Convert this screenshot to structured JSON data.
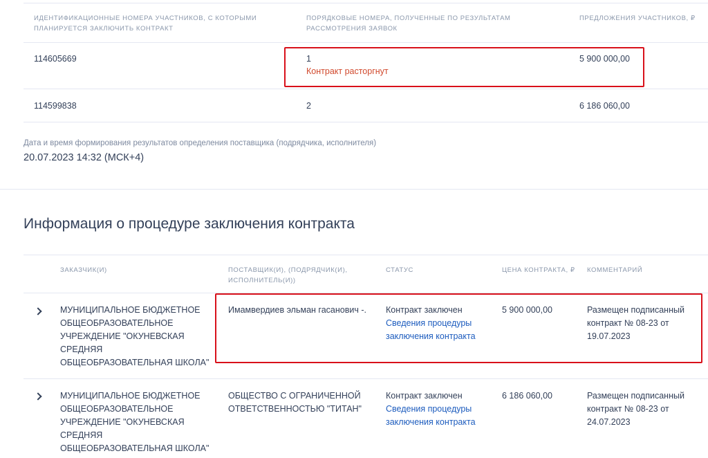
{
  "participants_table": {
    "headers": [
      "Идентификационные номера участников, с которыми планируется заключить контракт",
      "Порядковые номера, полученные по результатам рассмотрения заявок",
      "Предложения участников, ₽"
    ],
    "rows": [
      {
        "id": "114605669",
        "rank": "1",
        "rank_note": "Контракт расторгнут",
        "offer": "5 900 000,00"
      },
      {
        "id": "114599838",
        "rank": "2",
        "rank_note": "",
        "offer": "6 186 060,00"
      }
    ]
  },
  "results_datetime": {
    "label": "Дата и время формирования результатов определения поставщика (подрядчика, исполнителя)",
    "value": "20.07.2023 14:32 (МСК+4)"
  },
  "contract_section": {
    "title": "Информация о процедуре заключения контракта",
    "headers": [
      "Заказчик(и)",
      "Поставщик(и), (подрядчик(и), исполнитель(и))",
      "Статус",
      "Цена контракта, ₽",
      "Комментарий"
    ],
    "rows": [
      {
        "customer": "МУНИЦИПАЛЬНОЕ БЮДЖЕТНОЕ ОБЩЕОБРАЗОВАТЕЛЬНОЕ УЧРЕЖДЕНИЕ \"ОКУНЕВСКАЯ СРЕДНЯЯ ОБЩЕОБРАЗОВАТЕЛЬНАЯ ШКОЛА\"",
        "supplier": "Имамвердиев эльман гасанович -.",
        "status": "Контракт заключен",
        "status_link": "Сведения процедуры заключения контракта",
        "price": "5 900 000,00",
        "comment": "Размещен подписанный контракт № 08-23 от 19.07.2023"
      },
      {
        "customer": "МУНИЦИПАЛЬНОЕ БЮДЖЕТНОЕ ОБЩЕОБРАЗОВАТЕЛЬНОЕ УЧРЕЖДЕНИЕ \"ОКУНЕВСКАЯ СРЕДНЯЯ ОБЩЕОБРАЗОВАТЕЛЬНАЯ ШКОЛА\"",
        "supplier": "ОБЩЕСТВО С ОГРАНИЧЕННОЙ ОТВЕТСТВЕННОСТЬЮ \"ТИТАН\"",
        "status": "Контракт заключен",
        "status_link": "Сведения процедуры заключения контракта",
        "price": "6 186 060,00",
        "comment": "Размещен подписанный контракт № 08-23 от 24.07.2023"
      }
    ]
  },
  "icons": {
    "expand": "chevron-right-icon"
  },
  "colors": {
    "highlight_border": "#d8101a",
    "link": "#1d5cbe",
    "warning_text": "#d14a2e"
  }
}
